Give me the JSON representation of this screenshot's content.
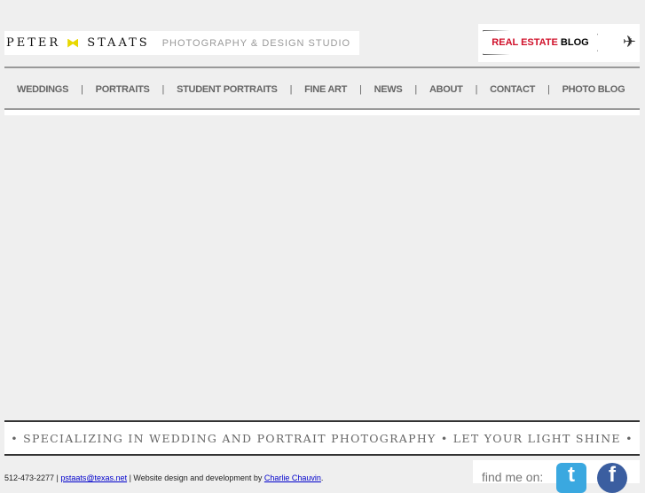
{
  "header": {
    "brand_left": "PETER",
    "brand_right": "STAATS",
    "studio": "PHOTOGRAPHY & DESIGN STUDIO",
    "blog_banner_red": "REAL ESTATE",
    "blog_banner_black": "BLOG"
  },
  "nav": [
    "WEDDINGS",
    "PORTRAITS",
    "STUDENT PORTRAITS",
    "FINE ART",
    "NEWS",
    "ABOUT",
    "CONTACT",
    "PHOTO BLOG"
  ],
  "nav_separator": "|",
  "tagline": "•  SPECIALIZING IN WEDDING AND PORTRAIT PHOTOGRAPHY  •  LET YOUR LIGHT SHINE  •",
  "footer": {
    "phone": "512-473-2277 | ",
    "email": "pstaats@texas.net",
    "mid": " | Website design and development by ",
    "designer": "Charlie Chauvin",
    "end": "."
  },
  "social": {
    "label": "find me on:",
    "twitter": "t",
    "facebook": "f"
  }
}
